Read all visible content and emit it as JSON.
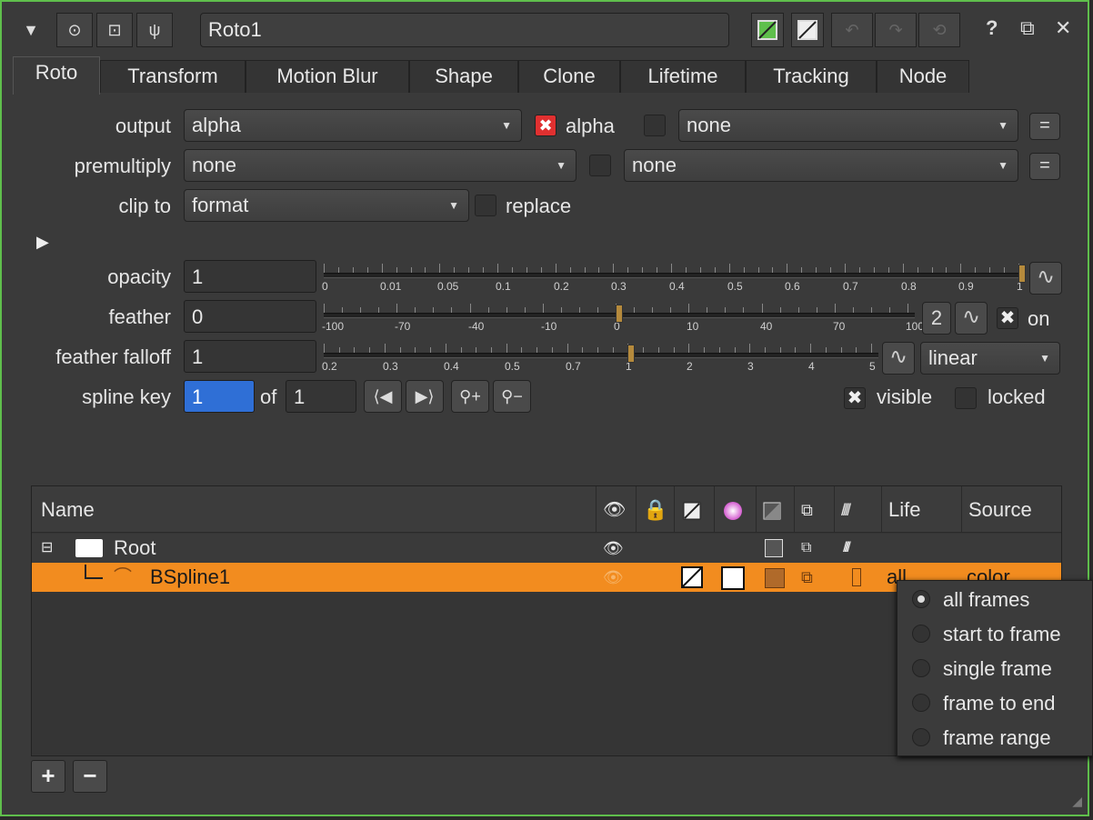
{
  "titlebar": {
    "node_name": "Roto1",
    "icons": [
      "collapse-arrow-icon",
      "node-circle-icon",
      "viewer-icon",
      "wrench-icon",
      "rgb-toggle-icon",
      "alpha-toggle-icon",
      "undo-icon",
      "redo-icon",
      "revert-icon",
      "help-icon",
      "float-icon",
      "close-icon"
    ],
    "help_label": "?",
    "close_label": "✕"
  },
  "tabs": [
    "Roto",
    "Transform",
    "Motion Blur",
    "Shape",
    "Clone",
    "Lifetime",
    "Tracking",
    "Node"
  ],
  "controls": {
    "output_label": "output",
    "output_value": "alpha",
    "output_check_label": "alpha",
    "output_channel2": "none",
    "premultiply_label": "premultiply",
    "premultiply_value": "none",
    "premultiply_channel2": "none",
    "clipto_label": "clip to",
    "clipto_value": "format",
    "replace_label": "replace",
    "eq_label": "=",
    "opacity_label": "opacity",
    "opacity_value": "1",
    "opacity_ticks": [
      "0",
      "0.01",
      "0.05",
      "0.1",
      "0.2",
      "0.3",
      "0.4",
      "0.5",
      "0.6",
      "0.7",
      "0.8",
      "0.9",
      "1"
    ],
    "feather_label": "feather",
    "feather_value": "0",
    "feather_ticks": [
      "-100",
      "-70",
      "-40",
      "-10",
      "0",
      "10",
      "40",
      "70",
      "100"
    ],
    "feather_count": "2",
    "feather_on_label": "on",
    "falloff_label": "feather falloff",
    "falloff_value": "1",
    "falloff_ticks": [
      "0.2",
      "0.3",
      "0.4",
      "0.5",
      "0.7",
      "1",
      "2",
      "3",
      "4",
      "5"
    ],
    "falloff_type": "linear",
    "splinekey_label": "spline key",
    "splinekey_value": "1",
    "of_label": "of",
    "splinekey_total": "1",
    "visible_label": "visible",
    "locked_label": "locked"
  },
  "tree": {
    "columns": {
      "name": "Name",
      "life": "Life",
      "source": "Source"
    },
    "rows": [
      {
        "name": "Root",
        "life": "",
        "source": ""
      },
      {
        "name": "BSpline1",
        "life": "all",
        "source": "color"
      }
    ]
  },
  "lifetime_menu": {
    "options": [
      "all frames",
      "start to frame",
      "single frame",
      "frame to end",
      "frame range"
    ],
    "selected": "all frames"
  },
  "footer": {
    "add_label": "+",
    "remove_label": "−"
  },
  "colors": {
    "accent_green": "#5fbf4c",
    "selection_orange": "#f28c1f",
    "field_blue": "#2f6fd6"
  }
}
